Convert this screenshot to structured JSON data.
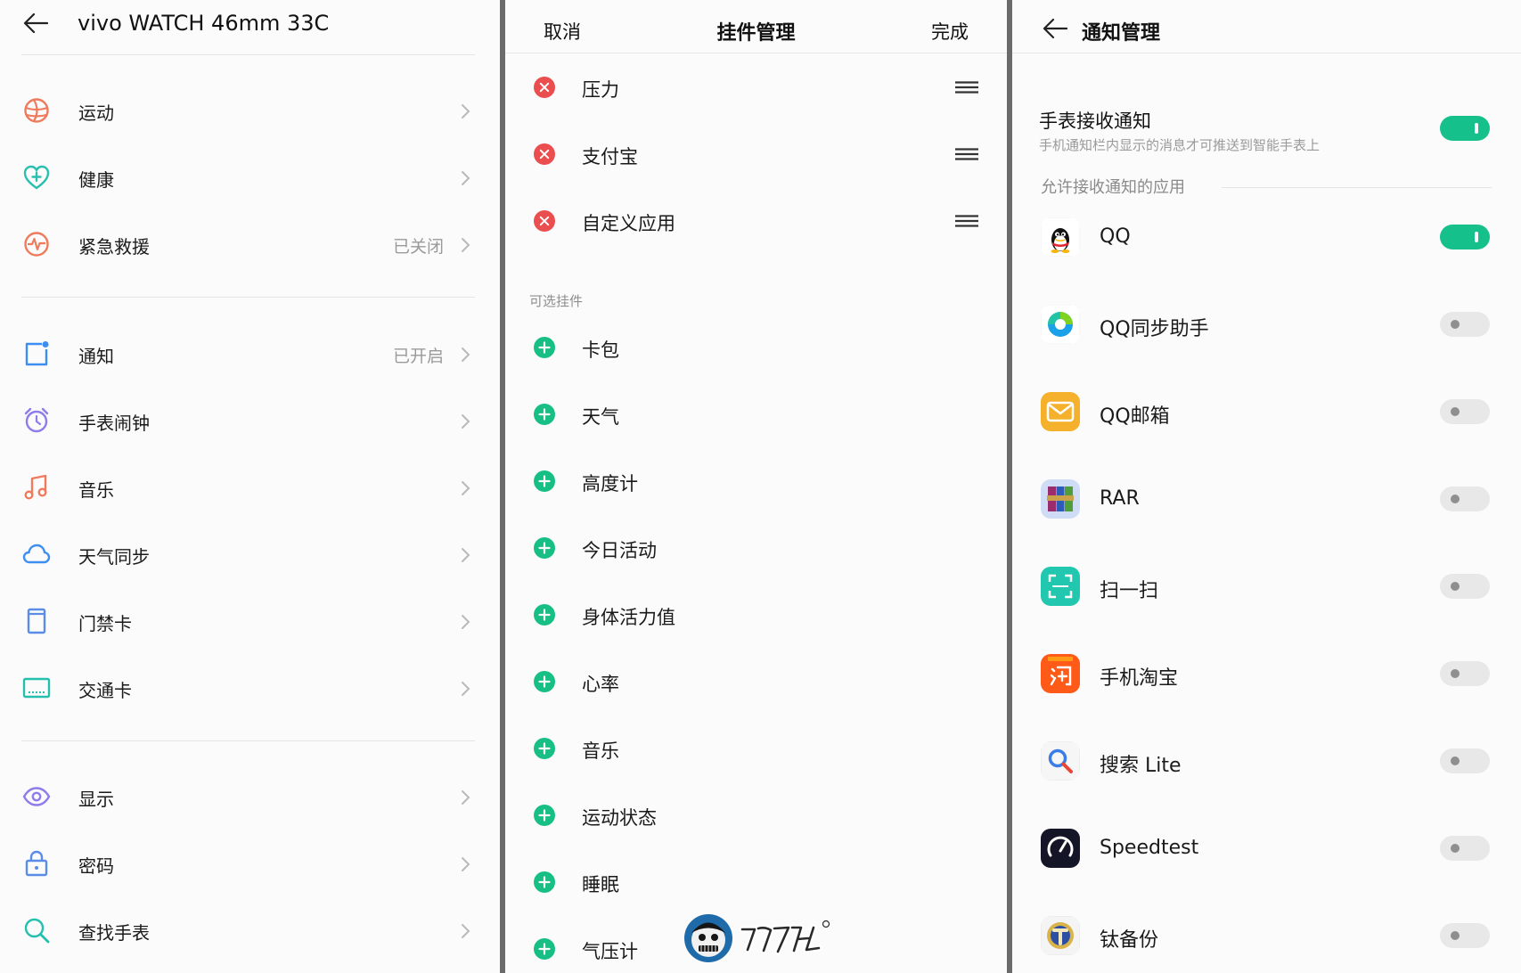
{
  "panel1": {
    "title": "vivo WATCH 46mm 33C",
    "items": [
      {
        "label": "运动",
        "value": "",
        "icon": "sport-ball-icon"
      },
      {
        "label": "健康",
        "value": "",
        "icon": "health-heart-icon"
      },
      {
        "label": "紧急救援",
        "value": "已关闭",
        "icon": "emergency-pulse-icon"
      },
      {
        "label": "通知",
        "value": "已开启",
        "icon": "notification-icon"
      },
      {
        "label": "手表闹钟",
        "value": "",
        "icon": "alarm-clock-icon"
      },
      {
        "label": "音乐",
        "value": "",
        "icon": "music-note-icon"
      },
      {
        "label": "天气同步",
        "value": "",
        "icon": "cloud-icon"
      },
      {
        "label": "门禁卡",
        "value": "",
        "icon": "access-card-icon"
      },
      {
        "label": "交通卡",
        "value": "",
        "icon": "transit-card-icon"
      },
      {
        "label": "显示",
        "value": "",
        "icon": "eye-icon"
      },
      {
        "label": "密码",
        "value": "",
        "icon": "lock-icon"
      },
      {
        "label": "查找手表",
        "value": "",
        "icon": "search-icon"
      }
    ],
    "colors": {
      "sport": "#ef7a5c",
      "health": "#2bbfb0",
      "alert": "#ef7a5c",
      "blue": "#3d8ef2",
      "purple": "#8f7bea",
      "teal": "#25bfae"
    }
  },
  "panel2": {
    "cancel": "取消",
    "title": "挂件管理",
    "done": "完成",
    "active": [
      "压力",
      "支付宝",
      "自定义应用"
    ],
    "section_label": "可选挂件",
    "optional": [
      "卡包",
      "天气",
      "高度计",
      "今日活动",
      "身体活力值",
      "心率",
      "音乐",
      "运动状态",
      "睡眠",
      "气压计"
    ],
    "colors": {
      "remove": "#ea4e4e",
      "add": "#17bf85"
    }
  },
  "panel3": {
    "title": "通知管理",
    "receive_title": "手表接收通知",
    "receive_sub": "手机通知栏内显示的消息才可推送到智能手表上",
    "receive_on": true,
    "apps_label": "允许接收通知的应用",
    "apps": [
      {
        "name": "QQ",
        "icon": "qq-penguin-icon",
        "on": true
      },
      {
        "name": "QQ同步助手",
        "icon": "qq-sync-icon",
        "on": false
      },
      {
        "name": "QQ邮箱",
        "icon": "qq-mail-icon",
        "on": false
      },
      {
        "name": "RAR",
        "icon": "rar-books-icon",
        "on": false
      },
      {
        "name": "扫一扫",
        "icon": "scan-icon",
        "on": false
      },
      {
        "name": "手机淘宝",
        "icon": "taobao-icon",
        "on": false
      },
      {
        "name": "搜索 Lite",
        "icon": "search-lite-icon",
        "on": false
      },
      {
        "name": "Speedtest",
        "icon": "speedtest-gauge-icon",
        "on": false
      },
      {
        "name": "钛备份",
        "icon": "titanium-backup-icon",
        "on": false
      }
    ],
    "colors": {
      "toggle_on": "#16c08a",
      "toggle_off": "#e8e8e8"
    }
  }
}
